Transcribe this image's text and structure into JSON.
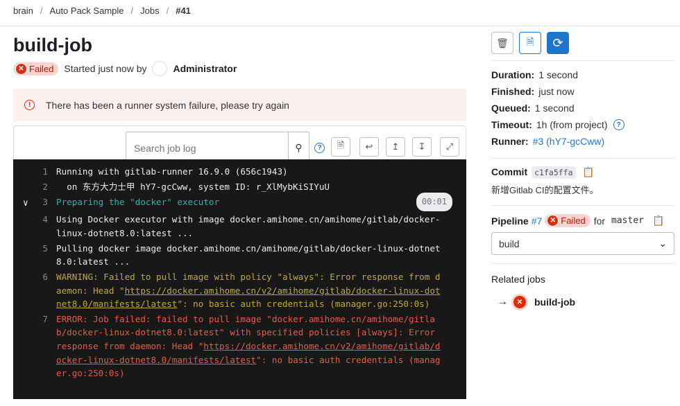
{
  "breadcrumb": [
    "brain",
    "Auto Pack Sample",
    "Jobs",
    "#41"
  ],
  "job": {
    "title": "build-job",
    "status": "Failed",
    "started": "Started just now by",
    "user": "Administrator"
  },
  "alert": "There has been a runner system failure, please try again",
  "search": {
    "placeholder": "Search job log"
  },
  "log": [
    {
      "n": "1",
      "text": "Running with gitlab-runner 16.9.0 (656c1943)",
      "type": "normal"
    },
    {
      "n": "2",
      "text": "  on 东方大力士甲 hY7-gcCww, system ID: r_XlMybKiSIYuU",
      "type": "normal"
    },
    {
      "n": "3",
      "text": "Preparing the \"docker\" executor",
      "type": "section",
      "duration": "00:01"
    },
    {
      "n": "4",
      "text": "Using Docker executor with image docker.amihome.cn/amihome/gitlab/docker-linux-dotnet8.0:latest ...",
      "type": "normal"
    },
    {
      "n": "5",
      "text": "Pulling docker image docker.amihome.cn/amihome/gitlab/docker-linux-dotnet8.0:latest ...",
      "type": "normal"
    },
    {
      "n": "6",
      "pre": "WARNING: Failed to pull image with policy \"always\": Error response from daemon: Head \"",
      "link": "https://docker.amihome.cn/v2/amihome/gitlab/docker-linux-dotnet8.0/manifests/latest",
      "post": "\": no basic auth credentials (manager.go:250:0s)",
      "type": "warning"
    },
    {
      "n": "7",
      "pre": "ERROR: Job failed: failed to pull image \"docker.amihome.cn/amihome/gitlab/docker-linux-dotnet8.0:latest\" with specified policies [always]: Error response from daemon: Head \"",
      "link": "https://docker.amihome.cn/v2/amihome/gitlab/docker-linux-dotnet8.0/manifests/latest",
      "post": "\": no basic auth credentials (manager.go:250:0s)",
      "type": "error"
    }
  ],
  "sidebar": {
    "duration_label": "Duration:",
    "duration": "1 second",
    "finished_label": "Finished:",
    "finished": "just now",
    "queued_label": "Queued:",
    "queued": "1 second",
    "timeout_label": "Timeout:",
    "timeout": "1h (from project)",
    "runner_label": "Runner:",
    "runner": "#3 (hY7-gcCww)",
    "commit_label": "Commit",
    "commit_sha": "c1fa5ffa",
    "commit_msg": "新增Gitlab CI的配置文件。",
    "pipeline_label": "Pipeline",
    "pipeline_id": "#7",
    "pipeline_status": "Failed",
    "for": "for",
    "branch": "master",
    "stage": "build",
    "related_label": "Related jobs",
    "related_job": "build-job"
  },
  "colors": {
    "accent": "#1f75cb",
    "danger": "#dd2b0e",
    "log_bg": "#181818"
  }
}
